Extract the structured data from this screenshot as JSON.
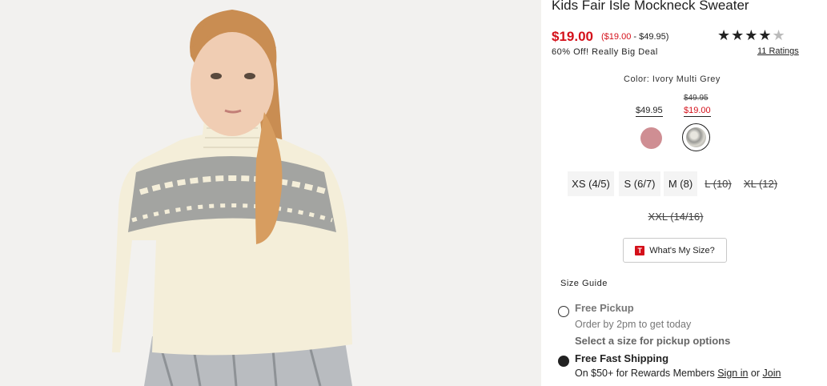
{
  "product": {
    "title": "Kids Fair Isle Mockneck Sweater",
    "price": "$19.00",
    "range_low": "($19.00",
    "range_high": " - $49.95)",
    "deal": "60% Off! Really Big Deal",
    "rating_stars": "★★★★",
    "rating_half": "★",
    "ratings_link": "11 Ratings",
    "rating_value": 4.5
  },
  "color": {
    "label": "Color: Ivory Multi Grey",
    "swatches": [
      {
        "name": "pink",
        "price": "$49.95",
        "hex": "#cf8e93"
      },
      {
        "name": "ivory-multi-grey",
        "original_price": "$49.95",
        "price": "$19.00",
        "selected": true
      }
    ]
  },
  "sizes": [
    {
      "label": "XS (4/5)",
      "available": true
    },
    {
      "label": "S (6/7)",
      "available": true
    },
    {
      "label": "M (8)",
      "available": true
    },
    {
      "label": "L (10)",
      "available": false
    },
    {
      "label": "XL (12)",
      "available": false
    },
    {
      "label": "XXL (14/16)",
      "available": false
    }
  ],
  "whats_my_size": {
    "icon_letter": "T",
    "label": "What's My Size?"
  },
  "size_guide": "Size Guide",
  "fulfillment": {
    "pickup_title": "Free Pickup",
    "pickup_sub": "Order by 2pm to get today",
    "pickup_note": "Select a size for pickup options",
    "ship_title": "Free Fast Shipping",
    "ship_sub_prefix": "On $50+ for Rewards Members ",
    "sign_in": "Sign in",
    "or": " or ",
    "join": "Join"
  },
  "colors": {
    "sale_red": "#d4101a",
    "photo_bg": "#f2f1ef"
  }
}
